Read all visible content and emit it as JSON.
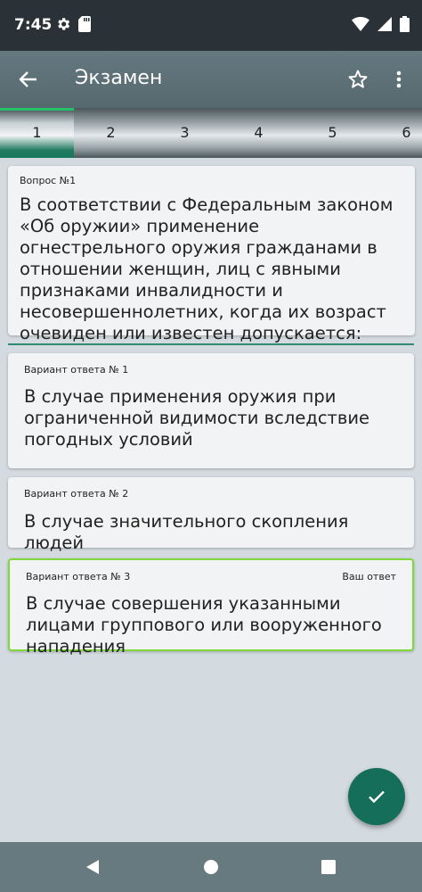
{
  "status_bar": {
    "time": "7:45",
    "icons": [
      "gear-icon",
      "sd-card-icon",
      "wifi-icon",
      "signal-icon",
      "battery-icon"
    ]
  },
  "app_bar": {
    "title": "Экзамен",
    "icons": [
      "back-arrow-icon",
      "star-outline-icon",
      "more-vert-icon"
    ]
  },
  "tabs": [
    "1",
    "2",
    "3",
    "4",
    "5",
    "6"
  ],
  "active_tab": "1",
  "question": {
    "label": "Вопрос №1",
    "text": "В соответствии с Федеральным законом «Об оружии» применение огнестрельного оружия гражданами в отношении женщин, лиц с явными признаками инвалидности и несовершеннолетних, когда их возраст очевиден или известен допускается:"
  },
  "answers": [
    {
      "label": "Вариант ответа № 1",
      "text": "В случае применения оружия при ограниченной видимости вследствие погодных условий"
    },
    {
      "label": "Вариант ответа № 2",
      "text": "В случае значительного скопления людей"
    },
    {
      "label": "Вариант ответа № 3",
      "text": "В случае совершения указанными лицами группового или вооруженного нападения",
      "tag": "Ваш ответ"
    }
  ],
  "fab": {
    "icon": "check-icon"
  },
  "nav": {
    "icons": [
      "nav-back-icon",
      "nav-home-icon",
      "nav-recent-icon"
    ]
  },
  "colors": {
    "app_bar": "#5f7379",
    "accent_green": "#146e5a",
    "selected_border": "#7ed93a",
    "background": "#d4dbe0"
  }
}
